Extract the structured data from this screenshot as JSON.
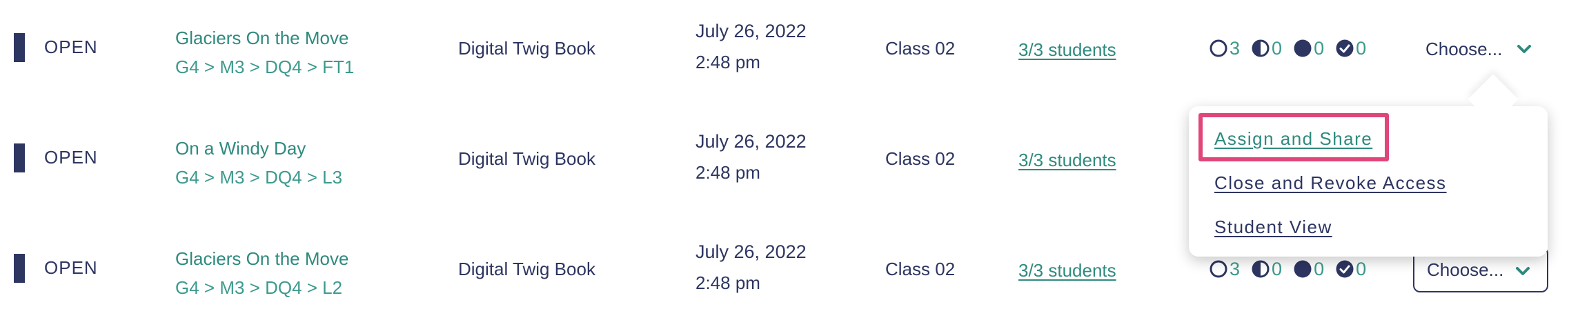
{
  "rows": [
    {
      "status": "OPEN",
      "title": "Glaciers On the Move",
      "path": "G4 > M3 > DQ4 > FT1",
      "book": "Digital Twig Book",
      "date": "July 26, 2022",
      "time": "2:48 pm",
      "class_name": "Class 02",
      "students": "3/3 students",
      "counts": {
        "not_started": "3",
        "in_progress": "0",
        "completed": "0",
        "submitted": "0"
      },
      "choose": "Choose..."
    },
    {
      "status": "OPEN",
      "title": "On a Windy Day",
      "path": "G4 > M3 > DQ4 > L3",
      "book": "Digital Twig Book",
      "date": "July 26, 2022",
      "time": "2:48 pm",
      "class_name": "Class 02",
      "students": "3/3 students"
    },
    {
      "status": "OPEN",
      "title": "Glaciers On the Move",
      "path": "G4 > M3 > DQ4 > L2",
      "book": "Digital Twig Book",
      "date": "July 26, 2022",
      "time": "2:48 pm",
      "class_name": "Class 02",
      "students": "3/3 students",
      "counts": {
        "not_started": "3",
        "in_progress": "0",
        "completed": "0",
        "submitted": "0"
      },
      "choose": "Choose..."
    }
  ],
  "dropdown": {
    "items": [
      "Assign and Share",
      "Close and Revoke Access",
      "Student View"
    ],
    "highlighted": "Assign and Share"
  },
  "colors": {
    "navy": "#2d3561",
    "teal": "#2f8a7e",
    "highlight": "#e0467a"
  },
  "icons": {
    "not_started": "empty-circle-icon",
    "in_progress": "half-circle-icon",
    "completed": "filled-circle-icon",
    "submitted": "check-circle-icon",
    "chevron": "chevron-down-icon"
  }
}
